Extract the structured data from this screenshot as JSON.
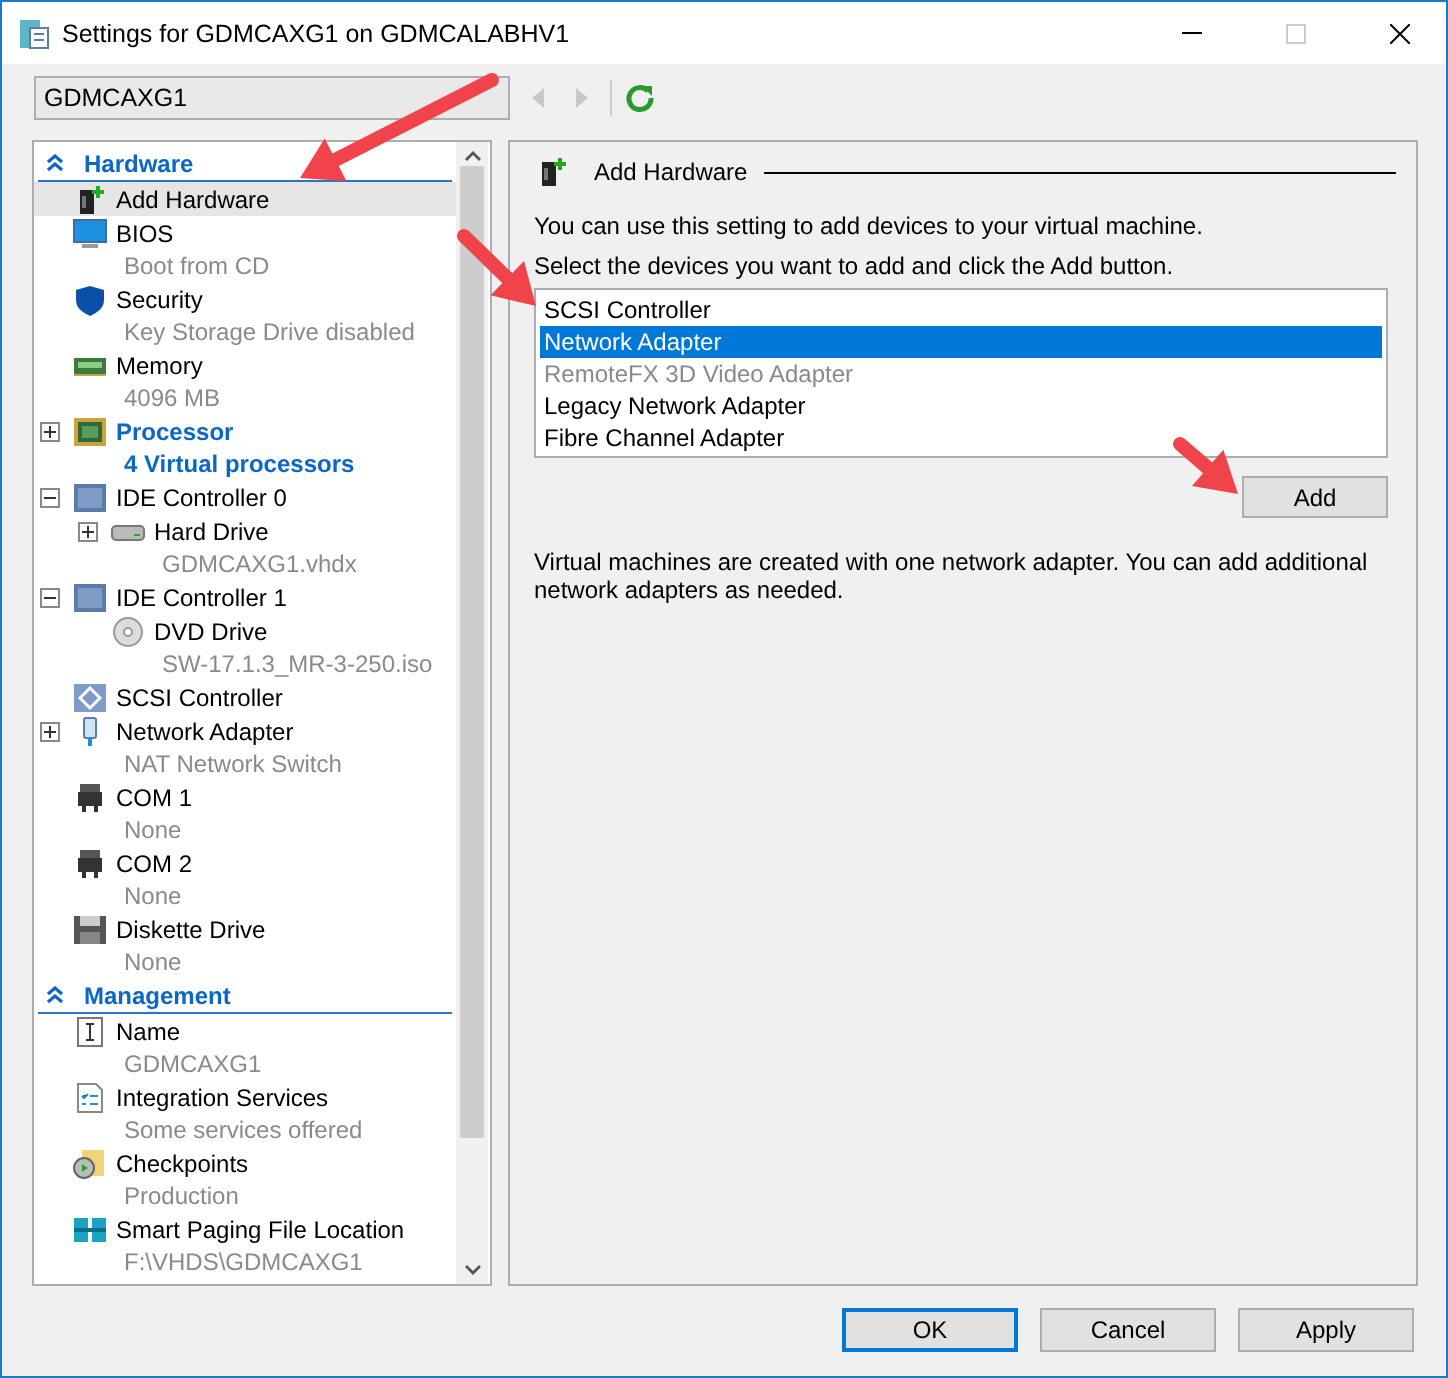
{
  "window": {
    "title": "Settings for GDMCAXG1 on GDMCALABHV1"
  },
  "vm_selector": {
    "value": "GDMCAXG1"
  },
  "tree": [
    {
      "title": "Hardware",
      "expanded": true,
      "items": [
        {
          "kind": "add",
          "label": "Add Hardware",
          "selected": true
        },
        {
          "kind": "bios",
          "label": "BIOS",
          "detail": "Boot from CD",
          "selected": false
        },
        {
          "kind": "security",
          "label": "Security",
          "detail": "Key Storage Drive disabled",
          "selected": false
        },
        {
          "kind": "memory",
          "label": "Memory",
          "detail": "4096 MB",
          "selected": false
        },
        {
          "kind": "processor",
          "label": "Processor",
          "detail": "4 Virtual processors",
          "selected": false,
          "expanded": false
        },
        {
          "kind": "controller",
          "label": "IDE Controller 0",
          "selected": false,
          "expanded": true,
          "children": [
            {
              "kind": "disk",
              "label": "Hard Drive",
              "detail": "GDMCAXG1.vhdx",
              "selected": false,
              "expanded": false
            }
          ]
        },
        {
          "kind": "controller",
          "label": "IDE Controller 1",
          "selected": false,
          "expanded": true,
          "children": [
            {
              "kind": "dvd",
              "label": "DVD Drive",
              "detail": "SW-17.1.3_MR-3-250.iso",
              "selected": false
            }
          ]
        },
        {
          "kind": "scsi",
          "label": "SCSI Controller",
          "selected": false
        },
        {
          "kind": "network",
          "label": "Network Adapter",
          "detail": "NAT Network Switch",
          "selected": false,
          "expanded": false
        },
        {
          "kind": "com",
          "label": "COM 1",
          "detail": "None",
          "selected": false
        },
        {
          "kind": "com",
          "label": "COM 2",
          "detail": "None",
          "selected": false
        },
        {
          "kind": "diskette",
          "label": "Diskette Drive",
          "detail": "None",
          "selected": false
        }
      ]
    },
    {
      "title": "Management",
      "expanded": true,
      "items": [
        {
          "kind": "name",
          "label": "Name",
          "detail": "GDMCAXG1",
          "selected": false
        },
        {
          "kind": "integration",
          "label": "Integration Services",
          "detail": "Some services offered",
          "selected": false
        },
        {
          "kind": "checkpoints",
          "label": "Checkpoints",
          "detail": "Production",
          "selected": false
        },
        {
          "kind": "paging",
          "label": "Smart Paging File Location",
          "detail": "F:\\VHDS\\GDMCAXG1",
          "selected": false
        }
      ]
    }
  ],
  "panel": {
    "title": "Add Hardware",
    "intro": "You can use this setting to add devices to your virtual machine.",
    "instruction": "Select the devices you want to add and click the Add button.",
    "devices": [
      {
        "label": "SCSI Controller",
        "selected": false,
        "disabled": false
      },
      {
        "label": "Network Adapter",
        "selected": true,
        "disabled": false
      },
      {
        "label": "RemoteFX 3D Video Adapter",
        "selected": false,
        "disabled": true
      },
      {
        "label": "Legacy Network Adapter",
        "selected": false,
        "disabled": false
      },
      {
        "label": "Fibre Channel Adapter",
        "selected": false,
        "disabled": false
      }
    ],
    "add_button": "Add",
    "note": "Virtual machines are created with one network adapter. You can add additional network adapters as needed."
  },
  "buttons": [
    {
      "label": "OK",
      "default": true
    },
    {
      "label": "Cancel",
      "default": false
    },
    {
      "label": "Apply",
      "default": false
    }
  ]
}
